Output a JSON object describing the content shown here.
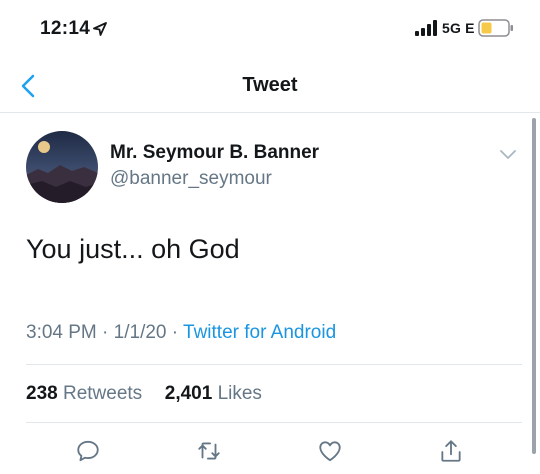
{
  "status_bar": {
    "time": "12:14",
    "network": "5G E",
    "icons": [
      "location-arrow-icon",
      "signal-icon",
      "battery-icon"
    ]
  },
  "nav": {
    "title": "Tweet",
    "back_icon": "chevron-left-icon"
  },
  "tweet": {
    "author": {
      "display_name": "Mr. Seymour B. Banner",
      "handle": "@banner_seymour"
    },
    "text": "You just... oh God",
    "time": "3:04 PM",
    "date": "1/1/20",
    "separator": "·",
    "source": "Twitter for Android",
    "retweet_count": "238",
    "retweet_label": "Retweets",
    "like_count": "2,401",
    "like_label": "Likes"
  },
  "actions": [
    "reply-icon",
    "retweet-icon",
    "like-icon",
    "share-icon"
  ],
  "colors": {
    "accent": "#1da1f2",
    "link": "#1b95e0",
    "muted": "#657786",
    "text": "#14171a",
    "divider": "#e1e8ed",
    "battery_fill": "#f7c948"
  }
}
